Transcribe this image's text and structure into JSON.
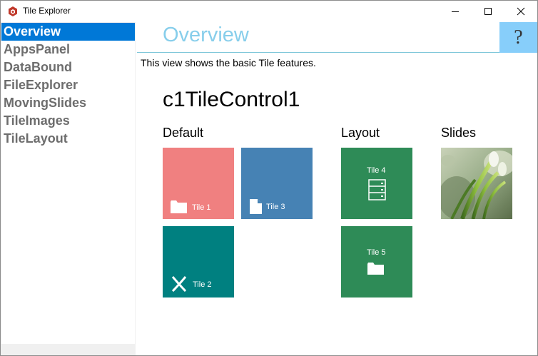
{
  "window": {
    "title": "Tile Explorer"
  },
  "sidebar": {
    "items": [
      {
        "label": "Overview",
        "selected": true
      },
      {
        "label": "AppsPanel"
      },
      {
        "label": "DataBound"
      },
      {
        "label": "FileExplorer"
      },
      {
        "label": "MovingSlides"
      },
      {
        "label": "TileImages"
      },
      {
        "label": "TileLayout"
      }
    ]
  },
  "main": {
    "title": "Overview",
    "help_symbol": "?",
    "description": "This view shows the basic Tile features.",
    "control_title": "c1TileControl1",
    "groups": [
      {
        "header": "Default",
        "tiles": [
          {
            "label": "Tile 1",
            "color": "#f08080",
            "icon": "folder-icon"
          },
          {
            "label": "Tile 3",
            "color": "#4682b4",
            "icon": "document-icon"
          },
          {
            "label": "Tile 2",
            "color": "#008080",
            "icon": "x-logo-icon"
          }
        ]
      },
      {
        "header": "Layout",
        "tiles": [
          {
            "label": "Tile 4",
            "color": "#2e8b57",
            "icon": "server-icon"
          },
          {
            "label": "Tile 5",
            "color": "#2e8b57",
            "icon": "folder-icon"
          }
        ]
      },
      {
        "header": "Slides",
        "tiles": [
          {
            "label": "",
            "icon": "snowdrop-flower-image"
          }
        ]
      }
    ]
  },
  "colors": {
    "accent": "#0078d7",
    "title_blue": "#87ceeb",
    "help_bg": "#87cefa"
  }
}
